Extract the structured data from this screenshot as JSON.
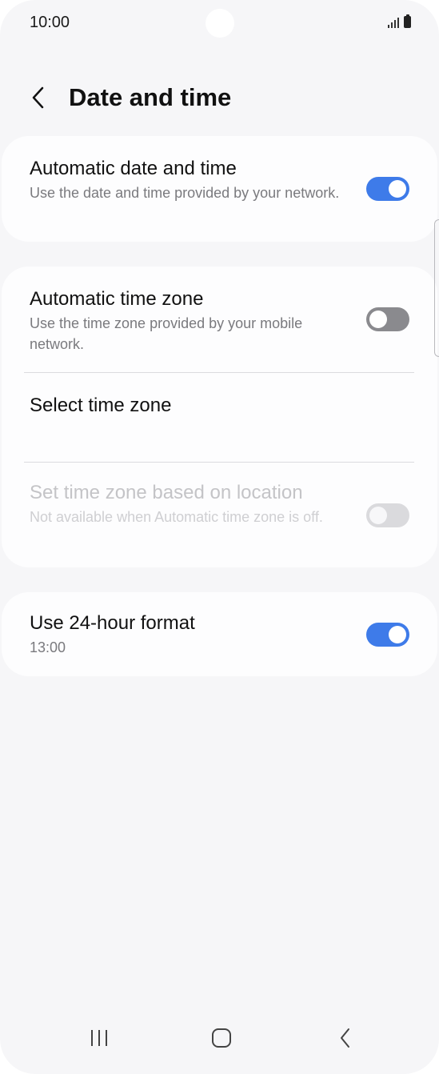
{
  "status_bar": {
    "time": "10:00",
    "icons": [
      "signal-icon",
      "battery-icon"
    ]
  },
  "header": {
    "title": "Date and time",
    "back_icon": "chevron-left-icon"
  },
  "settings": {
    "auto_date_time": {
      "title": "Automatic date and time",
      "subtitle": "Use the date and time provided by your network.",
      "enabled": true
    },
    "auto_time_zone": {
      "title": "Automatic time zone",
      "subtitle": "Use the time zone provided by your mobile network.",
      "enabled": false
    },
    "select_time_zone": {
      "title": "Select time zone"
    },
    "location_time_zone": {
      "title": "Set time zone based on location",
      "subtitle": "Not available when Automatic time zone is off.",
      "enabled": false,
      "disabled": true
    },
    "hour_format_24": {
      "title": "Use 24-hour format",
      "subtitle": "13:00",
      "enabled": true
    }
  },
  "colors": {
    "accent": "#3e7be9",
    "background": "#f6f6f8",
    "card": "#fdfdfe",
    "toggle_off": "#8a8a8e"
  },
  "navbar": {
    "icons": [
      "recent-apps-icon",
      "home-icon",
      "back-icon"
    ]
  }
}
